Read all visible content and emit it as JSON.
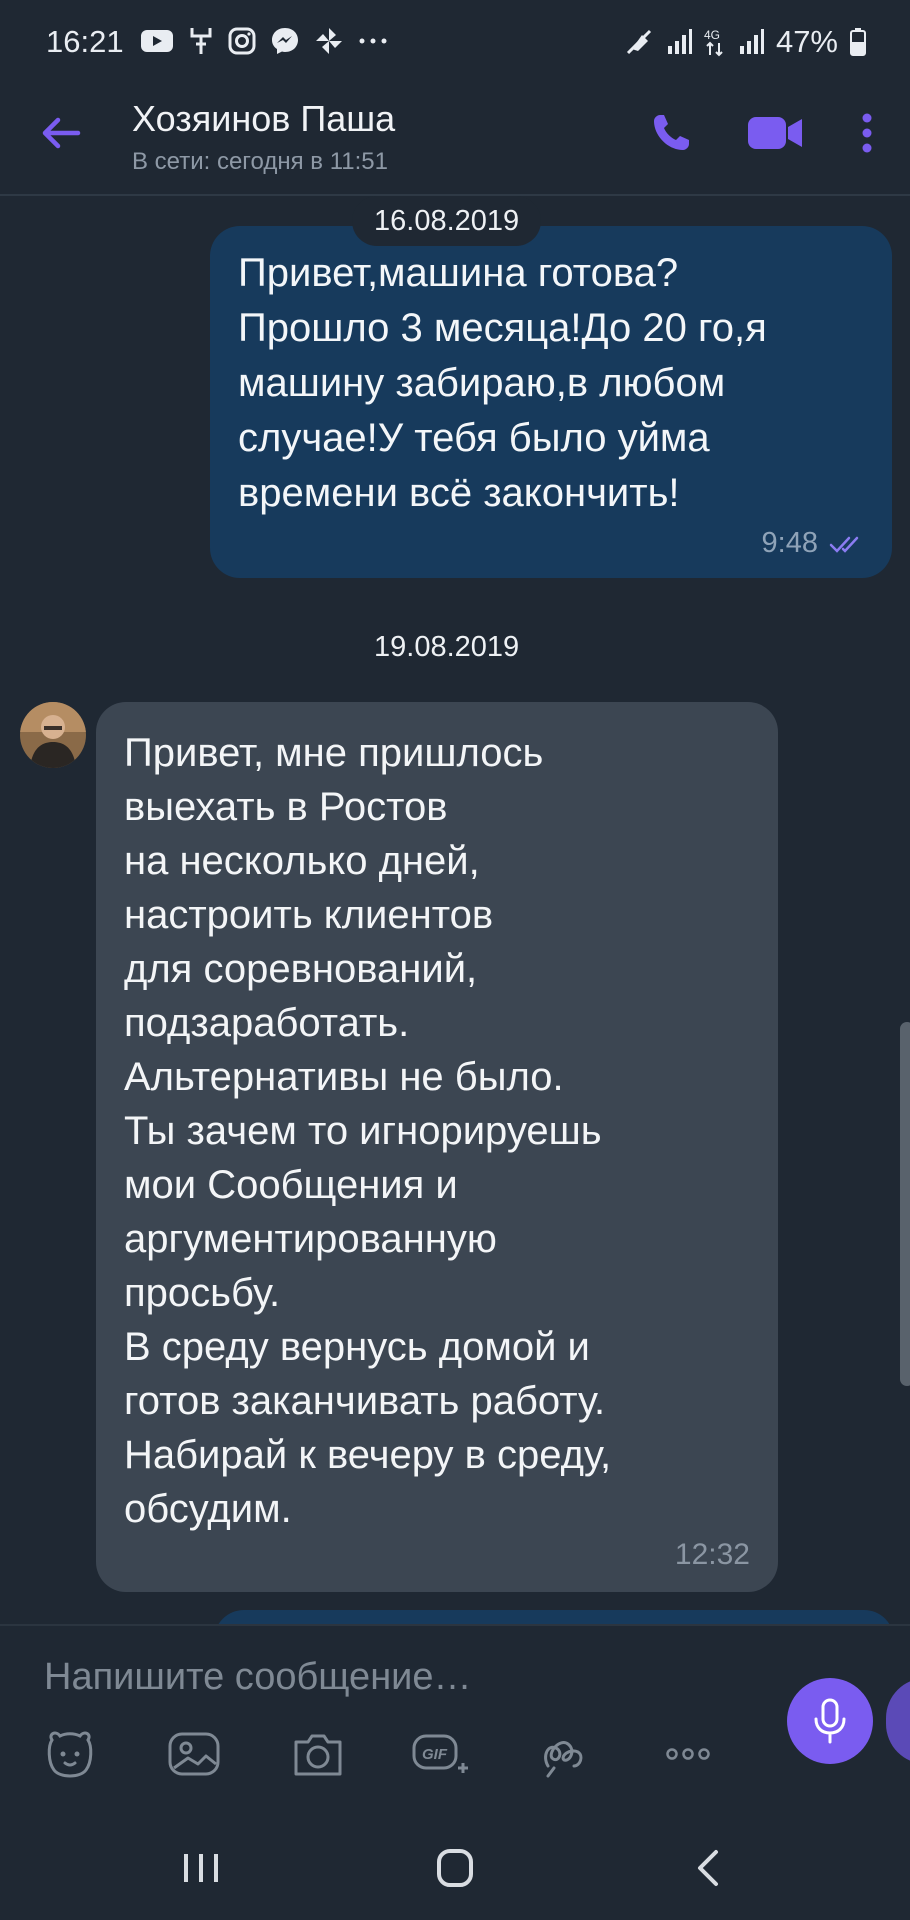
{
  "status_bar": {
    "time": "16:21",
    "battery": "47%",
    "left_icons": [
      "youtube-icon",
      "usb-icon",
      "instagram-icon",
      "messenger-icon",
      "pinwheel-icon",
      "more-dots-icon"
    ],
    "right_icons": [
      "mute-icon",
      "signal-icon",
      "4g-icon",
      "signal-icon",
      "battery-icon"
    ]
  },
  "header": {
    "contact_name": "Хозяинов Паша",
    "status": "В сети: сегодня в 11:51"
  },
  "messages": [
    {
      "date_label": "16.08.2019",
      "direction": "outgoing",
      "text": "Привет,машина готова?\nПрошло 3 месяца!До 20 го,я\nмашину забираю,в любом\nслучае!У тебя было уйма\nвремени всё закончить!",
      "time": "9:48",
      "read": true
    },
    {
      "date_label": "19.08.2019",
      "direction": "incoming",
      "text": "Привет, мне пришлось\nвыехать в Ростов\nна несколько дней,\nнастроить клиентов\nдля соревнований,\nподзаработать.\nАльтернативы не было.\nТы зачем то игнорируешь\nмои Сообщения и\nаргументированную\nпросьбу.\nВ среду вернусь домой и\nготов заканчивать работу.\nНабирай к вечеру в среду,\nобсудим.",
      "time": "12:32"
    }
  ],
  "composer": {
    "placeholder": "Напишите сообщение…",
    "tools": [
      "sticker-icon",
      "gallery-icon",
      "camera-icon",
      "gif-icon",
      "doodle-icon",
      "more-icon"
    ]
  },
  "colors": {
    "accent": "#7a5cf0",
    "background": "#1f2833",
    "outgoing_bubble": "#173a5c",
    "incoming_bubble": "#3c4652"
  }
}
